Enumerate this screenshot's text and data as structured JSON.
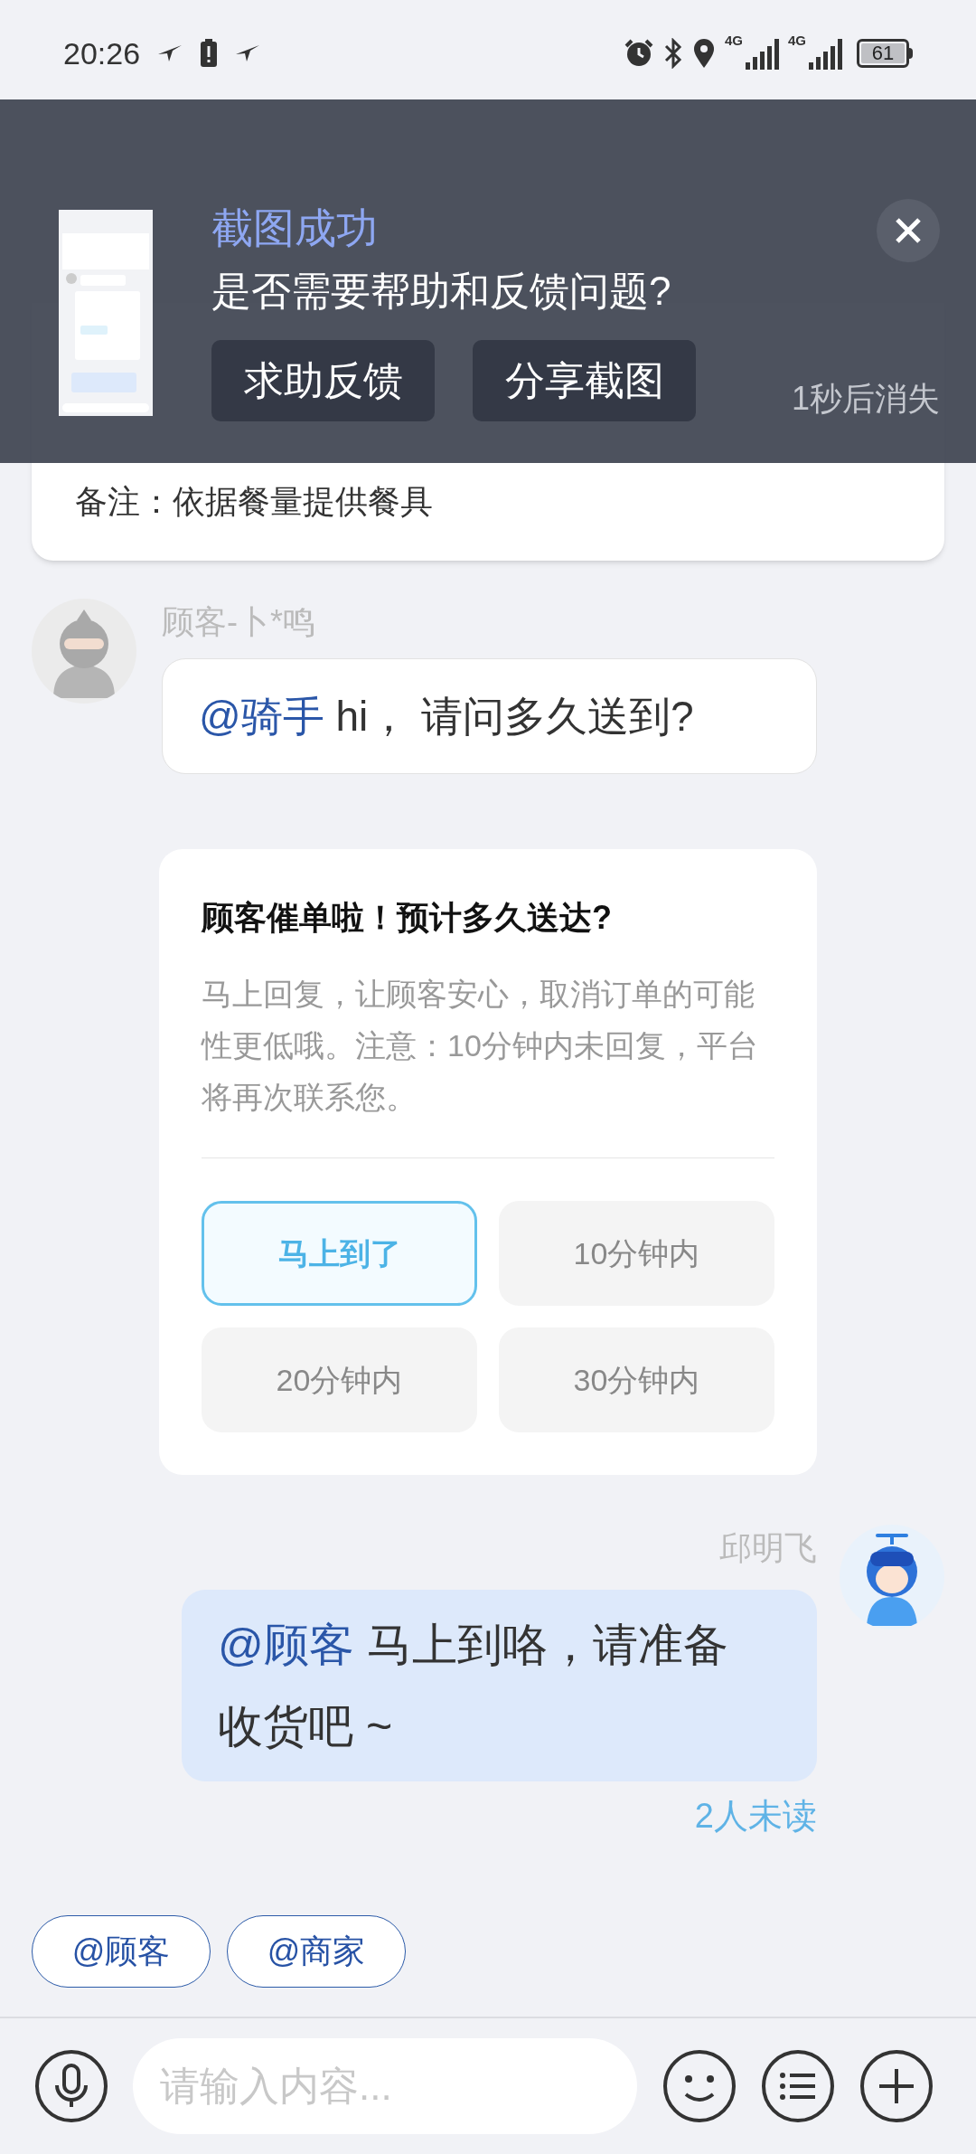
{
  "status_bar": {
    "time": "20:26",
    "network_1": "4G",
    "network_2": "4G",
    "battery": "61"
  },
  "order_card": {
    "note": "备注：依据餐量提供餐具"
  },
  "screenshot_toast": {
    "title": "截图成功",
    "question": "是否需要帮助和反馈问题?",
    "buttons": [
      "求助反馈",
      "分享截图"
    ],
    "countdown": "1秒后消失"
  },
  "messages": [
    {
      "kind": "incoming",
      "sender": "顾客-卜*鸣",
      "mention": "@骑手",
      "text": "hi， 请问多久送到?"
    },
    {
      "kind": "prompt",
      "title": "顾客催单啦！预计多久送达?",
      "body": "马上回复，让顾客安心，取消订单的可能性更低哦。注意：10分钟内未回复，平台将再次联系您。",
      "options": [
        {
          "label": "马上到了",
          "selected": true
        },
        {
          "label": "10分钟内",
          "selected": false
        },
        {
          "label": "20分钟内",
          "selected": false
        },
        {
          "label": "30分钟内",
          "selected": false
        }
      ]
    },
    {
      "kind": "outgoing",
      "sender": "邱明飞",
      "mention": "@顾客",
      "text": "马上到咯，请准备收货吧 ~",
      "read_status": "2人未读"
    }
  ],
  "quick_mentions": [
    "@顾客",
    "@商家"
  ],
  "composer": {
    "placeholder": "请输入内容..."
  }
}
